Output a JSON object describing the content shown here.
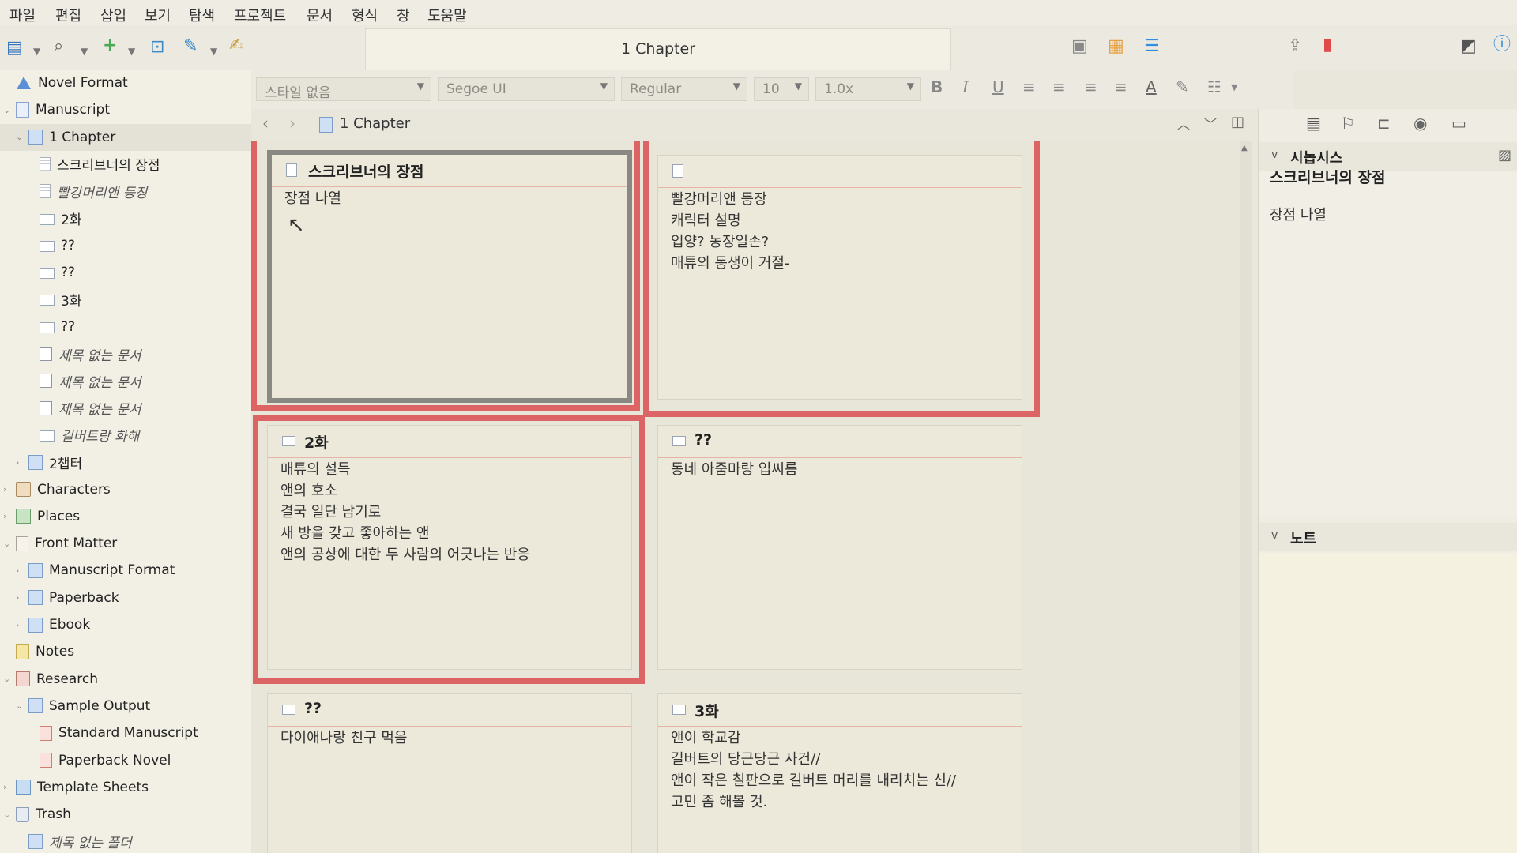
{
  "menu": [
    "파일",
    "편집",
    "삽입",
    "보기",
    "탐색",
    "프로젝트",
    "문서",
    "형식",
    "창",
    "도움말"
  ],
  "document_title": "1 Chapter",
  "format_bar": {
    "style": "스타일 없음",
    "font": "Segoe UI",
    "weight": "Regular",
    "size": "10",
    "spacing": "1.0x",
    "bold": "B",
    "italic": "I",
    "underline": "U",
    "text_color": "A"
  },
  "breadcrumb": "1 Chapter",
  "binder": [
    {
      "label": "Novel Format",
      "indent": 0,
      "icon": "novel-format-icon",
      "expand": ""
    },
    {
      "label": "Manuscript",
      "indent": 0,
      "icon": "manuscript-icon",
      "expand": "v"
    },
    {
      "label": "1 Chapter",
      "indent": 1,
      "icon": "folder-icon",
      "expand": "v",
      "selected": true
    },
    {
      "label": "스크리브너의 장점",
      "indent": 2,
      "icon": "document-icon"
    },
    {
      "label": "빨강머리앤 등장",
      "indent": 2,
      "icon": "document-icon",
      "italic": true
    },
    {
      "label": "2화",
      "indent": 2,
      "icon": "index-card-icon"
    },
    {
      "label": "??",
      "indent": 2,
      "icon": "index-card-icon"
    },
    {
      "label": "??",
      "indent": 2,
      "icon": "index-card-icon"
    },
    {
      "label": "3화",
      "indent": 2,
      "icon": "index-card-icon"
    },
    {
      "label": "??",
      "indent": 2,
      "icon": "index-card-icon"
    },
    {
      "label": "제목 없는 문서",
      "indent": 2,
      "icon": "empty-document-icon",
      "italic": true
    },
    {
      "label": "제목 없는 문서",
      "indent": 2,
      "icon": "empty-document-icon",
      "italic": true
    },
    {
      "label": "제목 없는 문서",
      "indent": 2,
      "icon": "empty-document-icon",
      "italic": true
    },
    {
      "label": "길버트랑 화해",
      "indent": 2,
      "icon": "index-card-icon",
      "italic": true
    },
    {
      "label": "2챕터",
      "indent": 1,
      "icon": "folder-icon",
      "expand": ">"
    },
    {
      "label": "Characters",
      "indent": 0,
      "icon": "characters-icon",
      "expand": ">"
    },
    {
      "label": "Places",
      "indent": 0,
      "icon": "places-icon",
      "expand": ">"
    },
    {
      "label": "Front Matter",
      "indent": 0,
      "icon": "front-matter-icon",
      "expand": "v"
    },
    {
      "label": "Manuscript Format",
      "indent": 1,
      "icon": "folder-icon",
      "expand": ">"
    },
    {
      "label": "Paperback",
      "indent": 1,
      "icon": "folder-icon",
      "expand": ">"
    },
    {
      "label": "Ebook",
      "indent": 1,
      "icon": "folder-icon",
      "expand": ">"
    },
    {
      "label": "Notes",
      "indent": 0,
      "icon": "notes-icon",
      "expand": ""
    },
    {
      "label": "Research",
      "indent": 0,
      "icon": "research-icon",
      "expand": "v"
    },
    {
      "label": "Sample Output",
      "indent": 1,
      "icon": "folder-icon",
      "expand": "v"
    },
    {
      "label": "Standard Manuscript",
      "indent": 2,
      "icon": "pdf-icon"
    },
    {
      "label": "Paperback Novel",
      "indent": 2,
      "icon": "pdf-icon"
    },
    {
      "label": "Template Sheets",
      "indent": 0,
      "icon": "template-sheets-icon",
      "expand": ">"
    },
    {
      "label": "Trash",
      "indent": 0,
      "icon": "trash-icon",
      "expand": "v"
    },
    {
      "label": "제목 없는 폴더",
      "indent": 1,
      "icon": "folder-icon",
      "italic": true
    }
  ],
  "cards": [
    {
      "title": "스크리브너의 장점",
      "lines": [
        "장점 나열"
      ],
      "icon": "document-icon"
    },
    {
      "title": "",
      "lines": [
        "빨강머리앤 등장",
        "캐릭터 설명",
        "입양? 농장일손?",
        "매튜의 동생이 거절-"
      ],
      "icon": "document-icon"
    },
    {
      "title": "2화",
      "lines": [
        "매튜의 설득",
        "앤의 호소",
        "결국 일단 남기로",
        "새 방을 갖고 좋아하는 앤",
        "앤의 공상에 대한 두 사람의 어긋나는 반응"
      ],
      "icon": "index-card-icon"
    },
    {
      "title": "??",
      "lines": [
        "동네 아줌마랑 입씨름"
      ],
      "icon": "index-card-icon"
    },
    {
      "title": "??",
      "lines": [
        "다이애나랑 친구 먹음"
      ],
      "icon": "index-card-icon"
    },
    {
      "title": "3화",
      "lines": [
        "앤이 학교감",
        "길버트의 당근당근 사건//",
        "앤이 작은 칠판으로 길버트 머리를 내리치는 신//",
        "고민 좀 해볼 것."
      ],
      "icon": "index-card-icon"
    }
  ],
  "inspector": {
    "synopsis_label": "시놉시스",
    "synopsis_title": "스크리브너의 장점",
    "synopsis_text": "장점 나열",
    "notes_label": "노트"
  },
  "colors": {
    "highlight": "#dd6465",
    "background": "#e9e6dc",
    "card": "#ede9da",
    "accent_blue": "#2f8fe0"
  }
}
